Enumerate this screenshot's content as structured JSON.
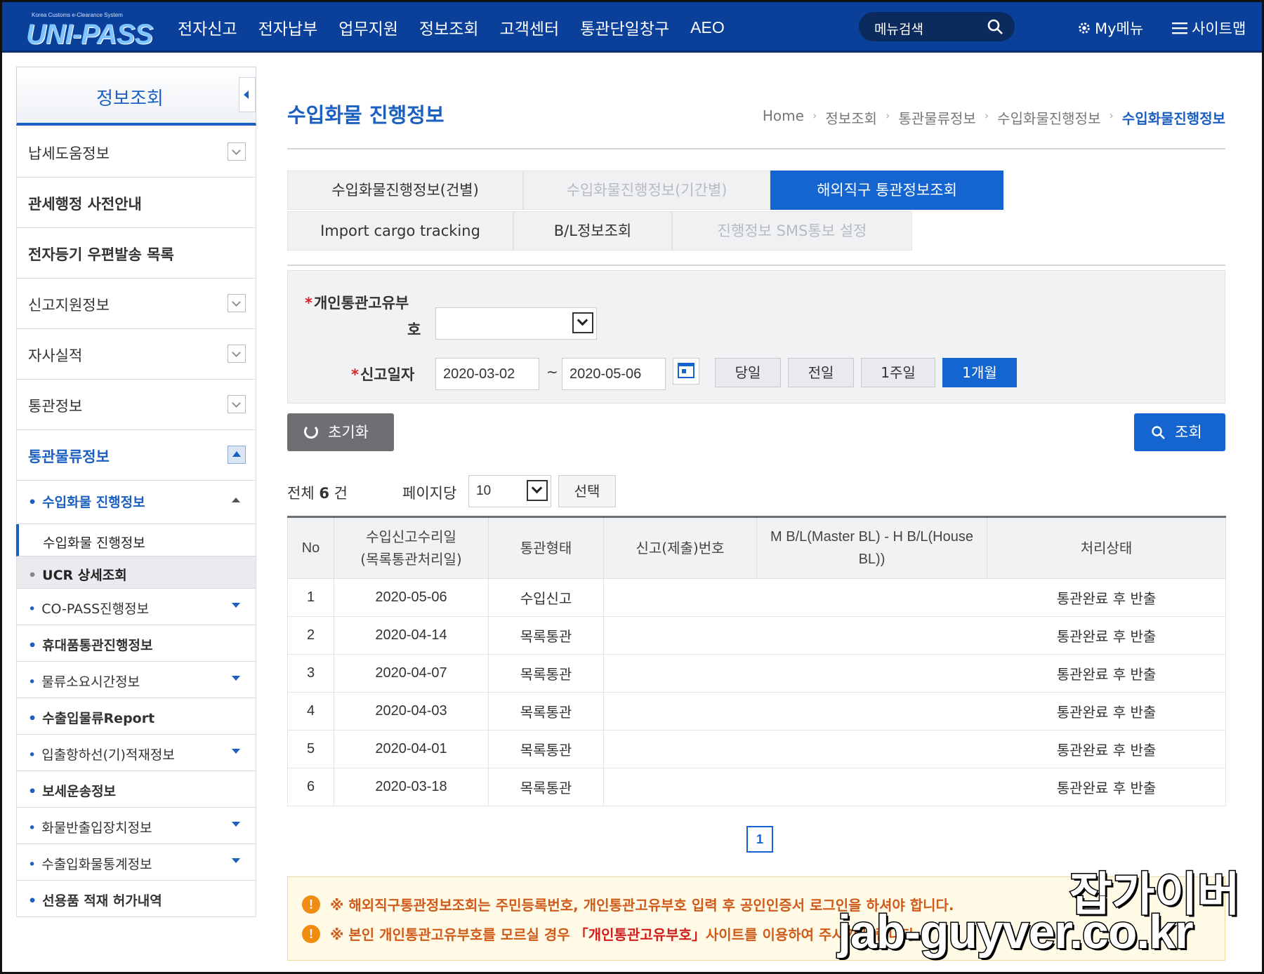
{
  "header": {
    "logo_sub": "Korea Customs e-Clearance System",
    "logo_main": "UNI-PASS",
    "nav": [
      "전자신고",
      "전자납부",
      "업무지원",
      "정보조회",
      "고객센터",
      "통관단일창구",
      "AEO"
    ],
    "menu_search_label": "메뉴검색",
    "my_menu": "My메뉴",
    "sitemap": "사이트맵"
  },
  "sidebar": {
    "title": "정보조회",
    "items": [
      {
        "label": "납세도움정보"
      },
      {
        "label": "관세행정 사전안내"
      },
      {
        "label": "전자등기 우편발송 목록"
      },
      {
        "label": "신고지원정보"
      },
      {
        "label": "자사실적"
      },
      {
        "label": "통관정보"
      },
      {
        "label": "통관물류정보"
      }
    ],
    "sub": {
      "open_label": "수입화물 진행정보",
      "current_label": "수입화물 진행정보",
      "ucr_label": "UCR 상세조회",
      "items": [
        {
          "label": "CO-PASS진행정보"
        },
        {
          "label": "휴대품통관진행정보"
        },
        {
          "label": "물류소요시간정보"
        },
        {
          "label": "수출입물류Report"
        },
        {
          "label": "입출항하선(기)적재정보"
        },
        {
          "label": "보세운송정보"
        },
        {
          "label": "화물반출입장치정보"
        },
        {
          "label": "수출입화물통계정보"
        },
        {
          "label": "선용품 적재 허가내역"
        }
      ]
    }
  },
  "main": {
    "title": "수입화물 진행정보",
    "breadcrumb": [
      "Home",
      "정보조회",
      "통관물류정보",
      "수입화물진행정보",
      "수입화물진행정보"
    ],
    "tabs_row1": [
      "수입화물진행정보(건별)",
      "수입화물진행정보(기간별)",
      "해외직구 통관정보조회"
    ],
    "tabs_row2": [
      "Import cargo tracking",
      "B/L정보조회",
      "진행정보 SMS통보 설정"
    ],
    "form": {
      "customs_code_label_1": "개인통관고유부",
      "customs_code_label_2": "호",
      "date_label": "신고일자",
      "date_from": "2020-03-02",
      "date_to": "2020-05-06",
      "tilde": "~",
      "quick": [
        "당일",
        "전일",
        "1주일",
        "1개월"
      ]
    },
    "reset_label": "초기화",
    "search_label": "조회",
    "total_prefix": "전체",
    "total_count": "6",
    "total_suffix": "건",
    "per_page_label": "페이지당",
    "per_page_value": "10",
    "choose_label": "선택",
    "table": {
      "headers": {
        "no": "No",
        "date_1": "수입신고수리일",
        "date_2": "(목록통관처리일)",
        "type": "통관형태",
        "decl": "신고(제출)번호",
        "bl_1": "M B/L(Master BL) - H B/L(House",
        "bl_2": "BL))",
        "status": "처리상태"
      },
      "rows": [
        {
          "no": "1",
          "date": "2020-05-06",
          "type": "수입신고",
          "status": "통관완료 후 반출"
        },
        {
          "no": "2",
          "date": "2020-04-14",
          "type": "목록통관",
          "status": "통관완료 후 반출"
        },
        {
          "no": "3",
          "date": "2020-04-07",
          "type": "목록통관",
          "status": "통관완료 후 반출"
        },
        {
          "no": "4",
          "date": "2020-04-03",
          "type": "목록통관",
          "status": "통관완료 후 반출"
        },
        {
          "no": "5",
          "date": "2020-04-01",
          "type": "목록통관",
          "status": "통관완료 후 반출"
        },
        {
          "no": "6",
          "date": "2020-03-18",
          "type": "목록통관",
          "status": "통관완료 후 반출"
        }
      ]
    },
    "page": "1",
    "notice": {
      "line1": "※ 해외직구통관정보조회는 주민등록번호, 개인통관고유부호 입력 후 공인인증서 로그인을 하셔야 합니다.",
      "line2_prefix": "※ 본인 개인통관고유부호를 모르실 경우",
      "line2_link": "「개인통관고유부호」",
      "line2_suffix": "사이트를 이용하여 주시기 바랍니다."
    }
  },
  "watermark": {
    "line1": "잡가이버",
    "line2": "jab-guyver.co.kr"
  },
  "colors": {
    "header_bg": "#0a3f9a",
    "accent": "#1565d0",
    "title_blue": "#1b5fc1",
    "notice_text": "#d05a1a"
  }
}
